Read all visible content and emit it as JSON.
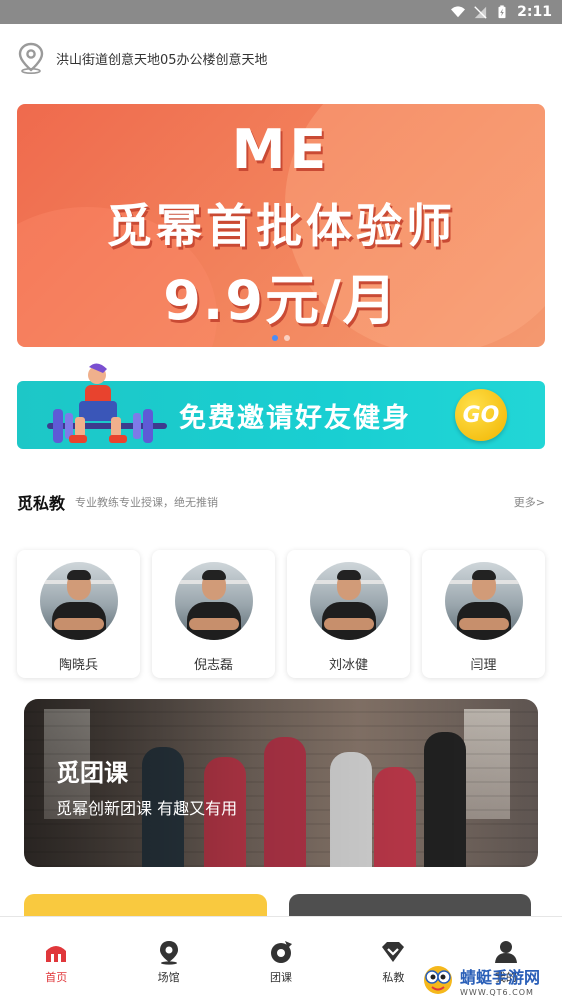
{
  "status_bar": {
    "time": "2:11"
  },
  "location": {
    "address": "洪山街道创意天地05办公楼创意天地"
  },
  "banner": {
    "brand": "ME",
    "headline": "觅幂首批体验师",
    "price_text": "9.9元/月",
    "slide_count": 2,
    "active_slide": 1
  },
  "invite": {
    "text": "免费邀请好友健身",
    "go_label": "GO"
  },
  "private_coach": {
    "title": "觅私教",
    "subtitle": "专业教练专业授课，绝无推销",
    "more": "更多>",
    "coaches": [
      {
        "name": "陶晓兵"
      },
      {
        "name": "倪志磊"
      },
      {
        "name": "刘冰健"
      },
      {
        "name": "闫理"
      }
    ]
  },
  "group_class": {
    "title": "觅团课",
    "subtitle": "觅幂创新团课 有趣又有用"
  },
  "tabs": [
    {
      "label": "首页",
      "icon": "home-icon",
      "active": true
    },
    {
      "label": "场馆",
      "icon": "location-icon",
      "active": false
    },
    {
      "label": "团课",
      "icon": "group-class-icon",
      "active": false
    },
    {
      "label": "私教",
      "icon": "private-coach-icon",
      "active": false
    },
    {
      "label": "我的",
      "icon": "user-icon",
      "active": false
    }
  ],
  "watermark": {
    "title": "蜻蜓手游网",
    "url": "WWW.QT6.COM"
  },
  "colors": {
    "accent": "#e0373b",
    "banner": "#ef6a4d",
    "invite": "#1dc7c7",
    "go": "#f1b400"
  }
}
